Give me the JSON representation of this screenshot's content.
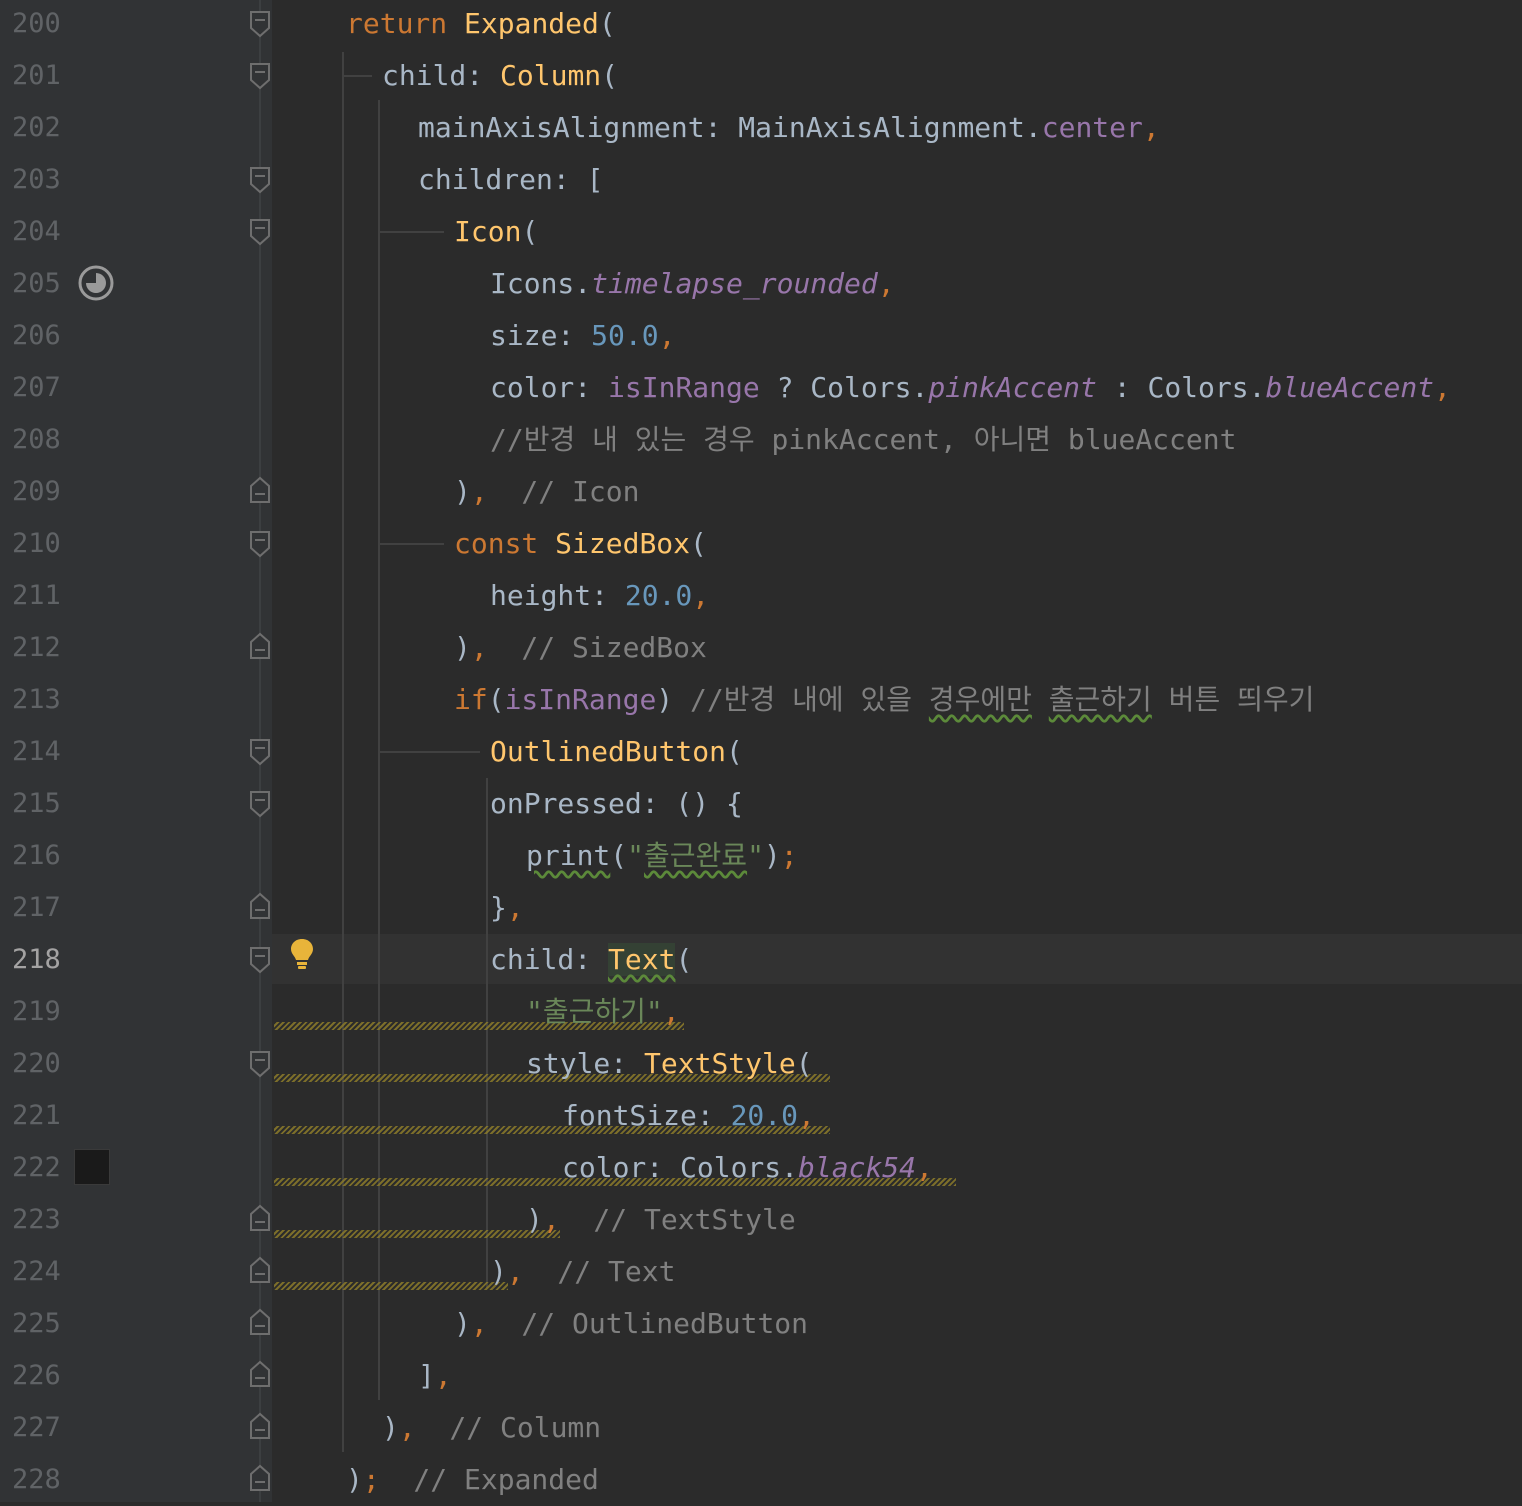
{
  "editor": {
    "line_numbers": [
      "200",
      "201",
      "202",
      "203",
      "204",
      "205",
      "206",
      "207",
      "208",
      "209",
      "210",
      "211",
      "212",
      "213",
      "214",
      "215",
      "216",
      "217",
      "218",
      "219",
      "220",
      "221",
      "222",
      "223",
      "224",
      "225",
      "226",
      "227",
      "228"
    ],
    "current_line": "218",
    "colors": {
      "background": "#2b2b2b",
      "gutter": "#313335",
      "keyword": "#cc7832",
      "class": "#ffc66d",
      "number": "#6897bb",
      "string": "#6a8759",
      "comment": "#808080",
      "field": "#9876aa",
      "text": "#a9b7c6",
      "bulb": "#e8b43a"
    },
    "gutter_icons": {
      "205": "timelapse-icon",
      "218": "lightbulb-icon",
      "222": "color-swatch-icon"
    },
    "lines": {
      "l200": {
        "kw_return": "return",
        "cls": "Expanded",
        "p": "("
      },
      "l201": {
        "a": "child: ",
        "cls": "Column",
        "p": "("
      },
      "l202": {
        "a": "mainAxisAlignment: MainAxisAlignment.",
        "field": "center",
        "comma": ","
      },
      "l203": {
        "a": "children: ["
      },
      "l204": {
        "cls": "Icon",
        "p": "("
      },
      "l205": {
        "a": "Icons.",
        "ital": "timelapse_rounded",
        "comma": ","
      },
      "l206": {
        "a": "size: ",
        "num": "50.0",
        "comma": ","
      },
      "l207": {
        "a": "color: ",
        "field": "isInRange",
        "b": " ? Colors.",
        "ital1": "pinkAccent",
        "c": " : Colors.",
        "ital2": "blueAccent",
        "comma": ","
      },
      "l208": {
        "cmt": "//반경 내 있는 경우 pinkAccent, 아니면 blueAccent"
      },
      "l209": {
        "a": ")",
        "comma": ",",
        "cmt": "  // Icon"
      },
      "l210": {
        "kw": "const ",
        "cls": "SizedBox",
        "p": "("
      },
      "l211": {
        "a": "height: ",
        "num": "20.0",
        "comma": ","
      },
      "l212": {
        "a": ")",
        "comma": ",",
        "cmt": "  // SizedBox"
      },
      "l213": {
        "kw": "if",
        "a": "(",
        "field": "isInRange",
        "b": ") ",
        "cmt1": "//반경 내에 있을 ",
        "cmt_typo1": "경우에만",
        "cmt2": " ",
        "cmt_typo2": "출근하기",
        "cmt3": " 버튼 띄우기"
      },
      "l214": {
        "cls": "OutlinedButton",
        "p": "("
      },
      "l215": {
        "a": "onPressed: () {"
      },
      "l216": {
        "fn": "print",
        "a": "(",
        "q1": "\"",
        "str": "출근완료",
        "q2": "\"",
        "b": ")",
        "semi": ";"
      },
      "l217": {
        "a": "}",
        "comma": ","
      },
      "l218": {
        "a": "child: ",
        "cls": "Text",
        "p": "("
      },
      "l219": {
        "str": "\"출근하기\"",
        "comma": ","
      },
      "l220": {
        "a": "style: ",
        "cls": "TextStyle",
        "p": "("
      },
      "l221": {
        "a": "fontSize: ",
        "num": "20.0",
        "comma": ","
      },
      "l222": {
        "a": "color: Colors.",
        "ital": "black54",
        "comma": ","
      },
      "l223": {
        "a": ")",
        "comma": ",",
        "cmt": "  // TextStyle"
      },
      "l224": {
        "a": ")",
        "comma": ",",
        "cmt": "  // Text"
      },
      "l225": {
        "a": ")",
        "comma": ",",
        "cmt": "  // OutlinedButton"
      },
      "l226": {
        "a": "]",
        "comma": ","
      },
      "l227": {
        "a": ")",
        "comma": ",",
        "cmt": "  // Column"
      },
      "l228": {
        "a": ")",
        "semi": ";",
        "cmt": "  // Expanded"
      }
    }
  }
}
